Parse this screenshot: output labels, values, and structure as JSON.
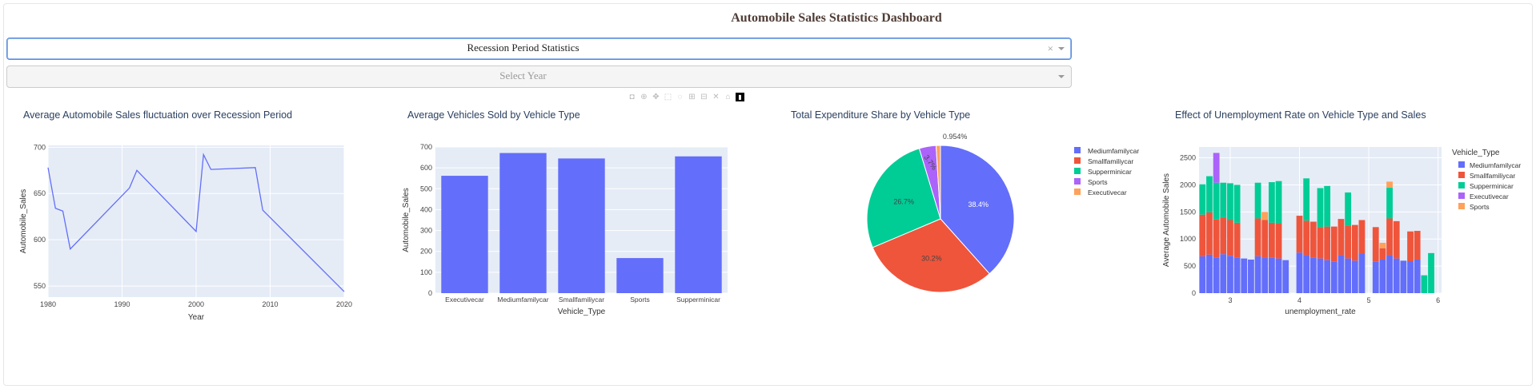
{
  "header": {
    "title": "Automobile Sales Statistics Dashboard"
  },
  "controls": {
    "report_type": {
      "value": "Recession Period Statistics",
      "clear": "×"
    },
    "year": {
      "placeholder": "Select Year"
    }
  },
  "theme": {
    "plot_bg": "#e5ecf6",
    "blue": "#636efa",
    "red": "#EF553B",
    "green": "#00cc96",
    "purple": "#ab63fa",
    "orange": "#FFA15A",
    "title_color": "#2a3f5f"
  },
  "chart_data": [
    {
      "type": "line",
      "title": "Average Automobile Sales fluctuation over Recession Period",
      "xlabel": "Year",
      "ylabel": "Automobile_Sales",
      "x": [
        1980,
        1981,
        1982,
        1983,
        1991,
        1992,
        2000,
        2001,
        2002,
        2008,
        2009,
        2020
      ],
      "y": [
        678,
        634,
        631,
        590,
        656,
        675,
        609,
        692,
        676,
        678,
        632,
        544
      ],
      "xlim": [
        1980,
        2020
      ],
      "ylim": [
        538,
        702
      ],
      "xticks": [
        1980,
        1990,
        2000,
        2010,
        2020
      ],
      "yticks": [
        550,
        600,
        650,
        700
      ]
    },
    {
      "type": "bar",
      "title": "Average Vehicles Sold by Vehicle Type",
      "xlabel": "Vehicle_Type",
      "ylabel": "Automobile_Sales",
      "categories": [
        "Executivecar",
        "Mediumfamilycar",
        "Smallfamiliycar",
        "Sports",
        "Supperminicar"
      ],
      "values": [
        562,
        671,
        645,
        168,
        655
      ],
      "ylim": [
        0,
        700
      ],
      "yticks": [
        0,
        100,
        200,
        300,
        400,
        500,
        600,
        700
      ]
    },
    {
      "type": "pie",
      "title": "Total Expenditure Share by Vehicle Type",
      "labels": [
        "Mediumfamilycar",
        "Smallfamiliycar",
        "Supperminicar",
        "Sports",
        "Executivecar"
      ],
      "values": [
        38.4,
        30.2,
        26.7,
        3.7,
        0.954
      ],
      "slice_labels": [
        "38.4%",
        "30.2%",
        "26.7%",
        "3.7%",
        "0.954%"
      ],
      "legend": "right"
    },
    {
      "type": "bar",
      "stacked": true,
      "title": "Effect of Unemployment Rate on Vehicle Type and Sales",
      "xlabel": "unemployment_rate",
      "ylabel": "Average Automobile Sales",
      "legend_title": "Vehicle_Type",
      "series_names": [
        "Mediumfamilycar",
        "Smallfamiliycar",
        "Supperminicar",
        "Executivecar",
        "Sports"
      ],
      "xlim": [
        2.55,
        6.05
      ],
      "ylim": [
        0,
        2700
      ],
      "xticks": [
        3,
        4,
        5,
        6
      ],
      "yticks": [
        0,
        500,
        1000,
        1500,
        2000,
        2500
      ],
      "bar_width": 0.09,
      "bars": [
        {
          "x": 2.6,
          "values": [
            680,
            770,
            560,
            0,
            0
          ]
        },
        {
          "x": 2.7,
          "values": [
            710,
            780,
            670,
            0,
            0
          ]
        },
        {
          "x": 2.8,
          "values": [
            660,
            700,
            680,
            550,
            0
          ]
        },
        {
          "x": 2.9,
          "values": [
            720,
            680,
            640,
            0,
            0
          ]
        },
        {
          "x": 3.0,
          "values": [
            690,
            660,
            680,
            0,
            0
          ]
        },
        {
          "x": 3.1,
          "values": [
            660,
            640,
            700,
            0,
            0
          ]
        },
        {
          "x": 3.2,
          "values": [
            640,
            0,
            0,
            0,
            0
          ]
        },
        {
          "x": 3.3,
          "values": [
            620,
            0,
            0,
            0,
            0
          ]
        },
        {
          "x": 3.4,
          "values": [
            680,
            700,
            660,
            0,
            0
          ]
        },
        {
          "x": 3.5,
          "values": [
            650,
            700,
            0,
            0,
            150
          ]
        },
        {
          "x": 3.6,
          "values": [
            660,
            640,
            750,
            0,
            0
          ]
        },
        {
          "x": 3.7,
          "values": [
            640,
            650,
            780,
            0,
            0
          ]
        },
        {
          "x": 3.8,
          "values": [
            610,
            0,
            0,
            0,
            0
          ]
        },
        {
          "x": 4.0,
          "values": [
            750,
            680,
            0,
            0,
            0
          ]
        },
        {
          "x": 4.1,
          "values": [
            700,
            640,
            780,
            0,
            0
          ]
        },
        {
          "x": 4.2,
          "values": [
            660,
            660,
            0,
            0,
            0
          ]
        },
        {
          "x": 4.3,
          "values": [
            640,
            580,
            720,
            0,
            0
          ]
        },
        {
          "x": 4.4,
          "values": [
            610,
            620,
            750,
            0,
            0
          ]
        },
        {
          "x": 4.5,
          "values": [
            580,
            650,
            0,
            0,
            0
          ]
        },
        {
          "x": 4.6,
          "values": [
            700,
            670,
            0,
            0,
            0
          ]
        },
        {
          "x": 4.7,
          "values": [
            640,
            600,
            620,
            0,
            0
          ]
        },
        {
          "x": 4.8,
          "values": [
            600,
            660,
            0,
            0,
            0
          ]
        },
        {
          "x": 4.9,
          "values": [
            730,
            620,
            0,
            0,
            0
          ]
        },
        {
          "x": 5.1,
          "values": [
            580,
            640,
            0,
            0,
            0
          ]
        },
        {
          "x": 5.2,
          "values": [
            620,
            210,
            0,
            0,
            100
          ]
        },
        {
          "x": 5.3,
          "values": [
            700,
            680,
            570,
            0,
            110
          ]
        },
        {
          "x": 5.4,
          "values": [
            640,
            690,
            0,
            0,
            0
          ]
        },
        {
          "x": 5.5,
          "values": [
            600,
            0,
            0,
            0,
            0
          ]
        },
        {
          "x": 5.6,
          "values": [
            590,
            550,
            0,
            0,
            0
          ]
        },
        {
          "x": 5.7,
          "values": [
            620,
            530,
            0,
            0,
            0
          ]
        },
        {
          "x": 5.8,
          "values": [
            0,
            0,
            330,
            0,
            0
          ]
        },
        {
          "x": 5.9,
          "values": [
            0,
            0,
            740,
            0,
            0
          ]
        }
      ]
    }
  ]
}
